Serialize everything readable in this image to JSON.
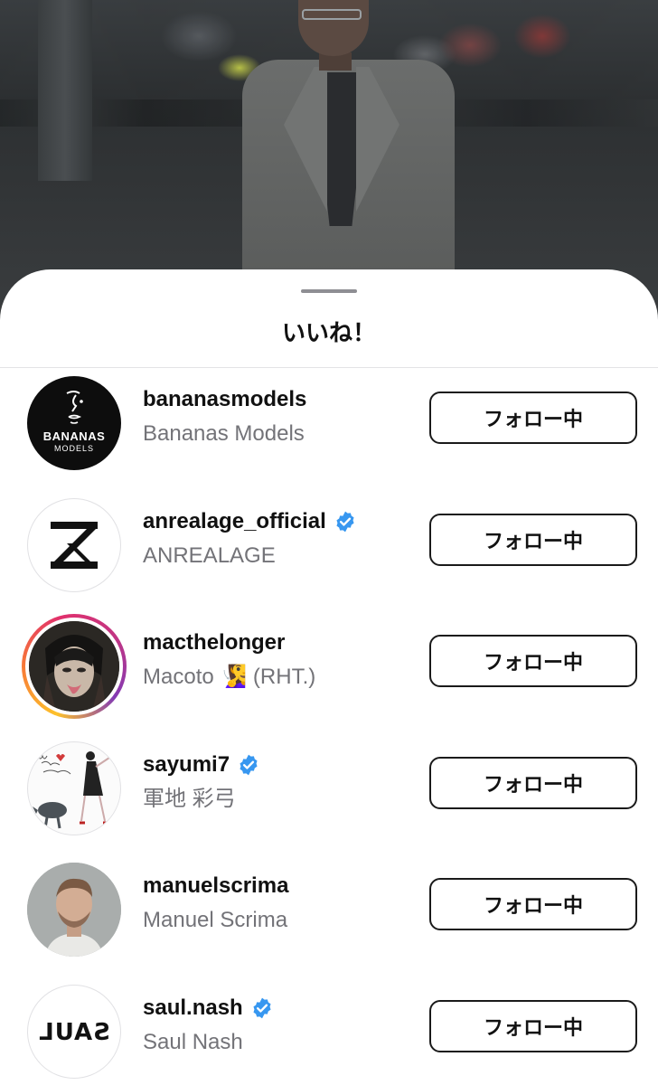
{
  "sheet": {
    "title": "いいね！"
  },
  "users": [
    {
      "username": "bananasmodels",
      "full_name": "Bananas Models",
      "verified": false,
      "avatar": "bananas-models-logo",
      "avatar_text": "BANANAS",
      "avatar_subtext": "MODELS",
      "button": "フォロー中"
    },
    {
      "username": "anrealage_official",
      "full_name": "ANREALAGE",
      "verified": true,
      "avatar": "anrealage-logo",
      "button": "フォロー中"
    },
    {
      "username": "macthelonger",
      "full_name": "Macoto 🧏‍♀️ (RHT.)",
      "verified": false,
      "has_story": true,
      "avatar": "portrait-photo",
      "button": "フォロー中"
    },
    {
      "username": "sayumi7",
      "full_name": "軍地 彩弓",
      "verified": true,
      "avatar": "we-love-sayumi-illustration",
      "button": "フォロー中"
    },
    {
      "username": "manuelscrima",
      "full_name": "Manuel Scrima",
      "verified": false,
      "avatar": "portrait-photo",
      "button": "フォロー中"
    },
    {
      "username": "saul.nash",
      "full_name": "Saul Nash",
      "verified": true,
      "avatar": "saul-logo",
      "avatar_text": "SAUL",
      "button": "フォロー中"
    }
  ],
  "colors": {
    "verified": "#3797f0",
    "secondary_text": "#737378",
    "sheet_background": "#ffffff"
  }
}
